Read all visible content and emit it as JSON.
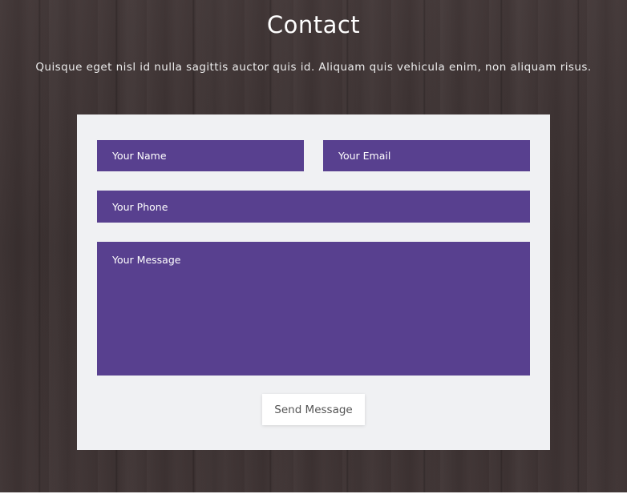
{
  "contact": {
    "title": "Contact",
    "subtitle": "Quisque eget nisl id nulla sagittis auctor quis id. Aliquam quis vehicula enim, non aliquam risus."
  },
  "form": {
    "name_placeholder": "Your Name",
    "email_placeholder": "Your Email",
    "phone_placeholder": "Your Phone",
    "message_placeholder": "Your Message",
    "send_label": "Send Message"
  },
  "colors": {
    "field_background": "#58408f",
    "card_background": "#f0f1f3",
    "section_background": "#3d3232"
  }
}
